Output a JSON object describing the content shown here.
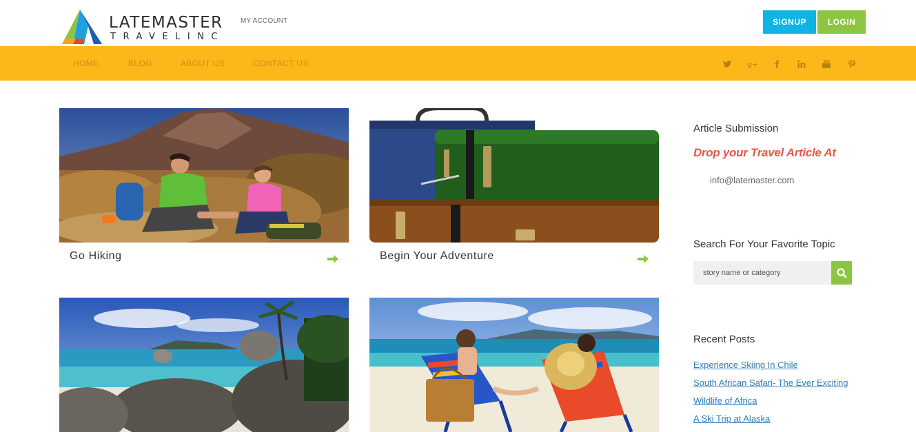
{
  "brand": {
    "name": "LATEMASTER",
    "tagline": "TRAVELINC"
  },
  "header": {
    "my_account": "MY ACCOUNT",
    "signup": "SIGNUP",
    "login": "LOGIN"
  },
  "nav": {
    "items": [
      {
        "label": "HOME"
      },
      {
        "label": "BLOG"
      },
      {
        "label": "ABOUT US"
      },
      {
        "label": "CONTACT US"
      }
    ],
    "social_icons": [
      "twitter-icon",
      "google-plus-icon",
      "facebook-icon",
      "linkedin-icon",
      "youtube-icon",
      "pinterest-icon"
    ]
  },
  "cards": [
    {
      "title": "Go Hiking",
      "image": "hikers-on-mountain"
    },
    {
      "title": "Begin Your Adventure",
      "image": "stacked-suitcases"
    },
    {
      "title": "",
      "image": "tropical-beach-rocks"
    },
    {
      "title": "",
      "image": "couple-on-beach-chairs"
    }
  ],
  "sidebar": {
    "article_heading": "Article Submission",
    "drop_text": "Drop your Travel Article At",
    "email": "info@latemaster.com",
    "search_heading": "Search For Your Favorite Topic",
    "search_placeholder": "story name or category",
    "recent_heading": "Recent Posts",
    "recent_posts": [
      "Experience Skiing In Chile",
      "South African Safari- The Ever Exciting",
      "Wildlife of Africa",
      "A Ski Trip at Alaska"
    ]
  },
  "colors": {
    "nav_bg": "#fcb819",
    "signup": "#10b3e6",
    "login": "#8cc541",
    "accent_red": "#e9584b",
    "link": "#2f7fba"
  }
}
